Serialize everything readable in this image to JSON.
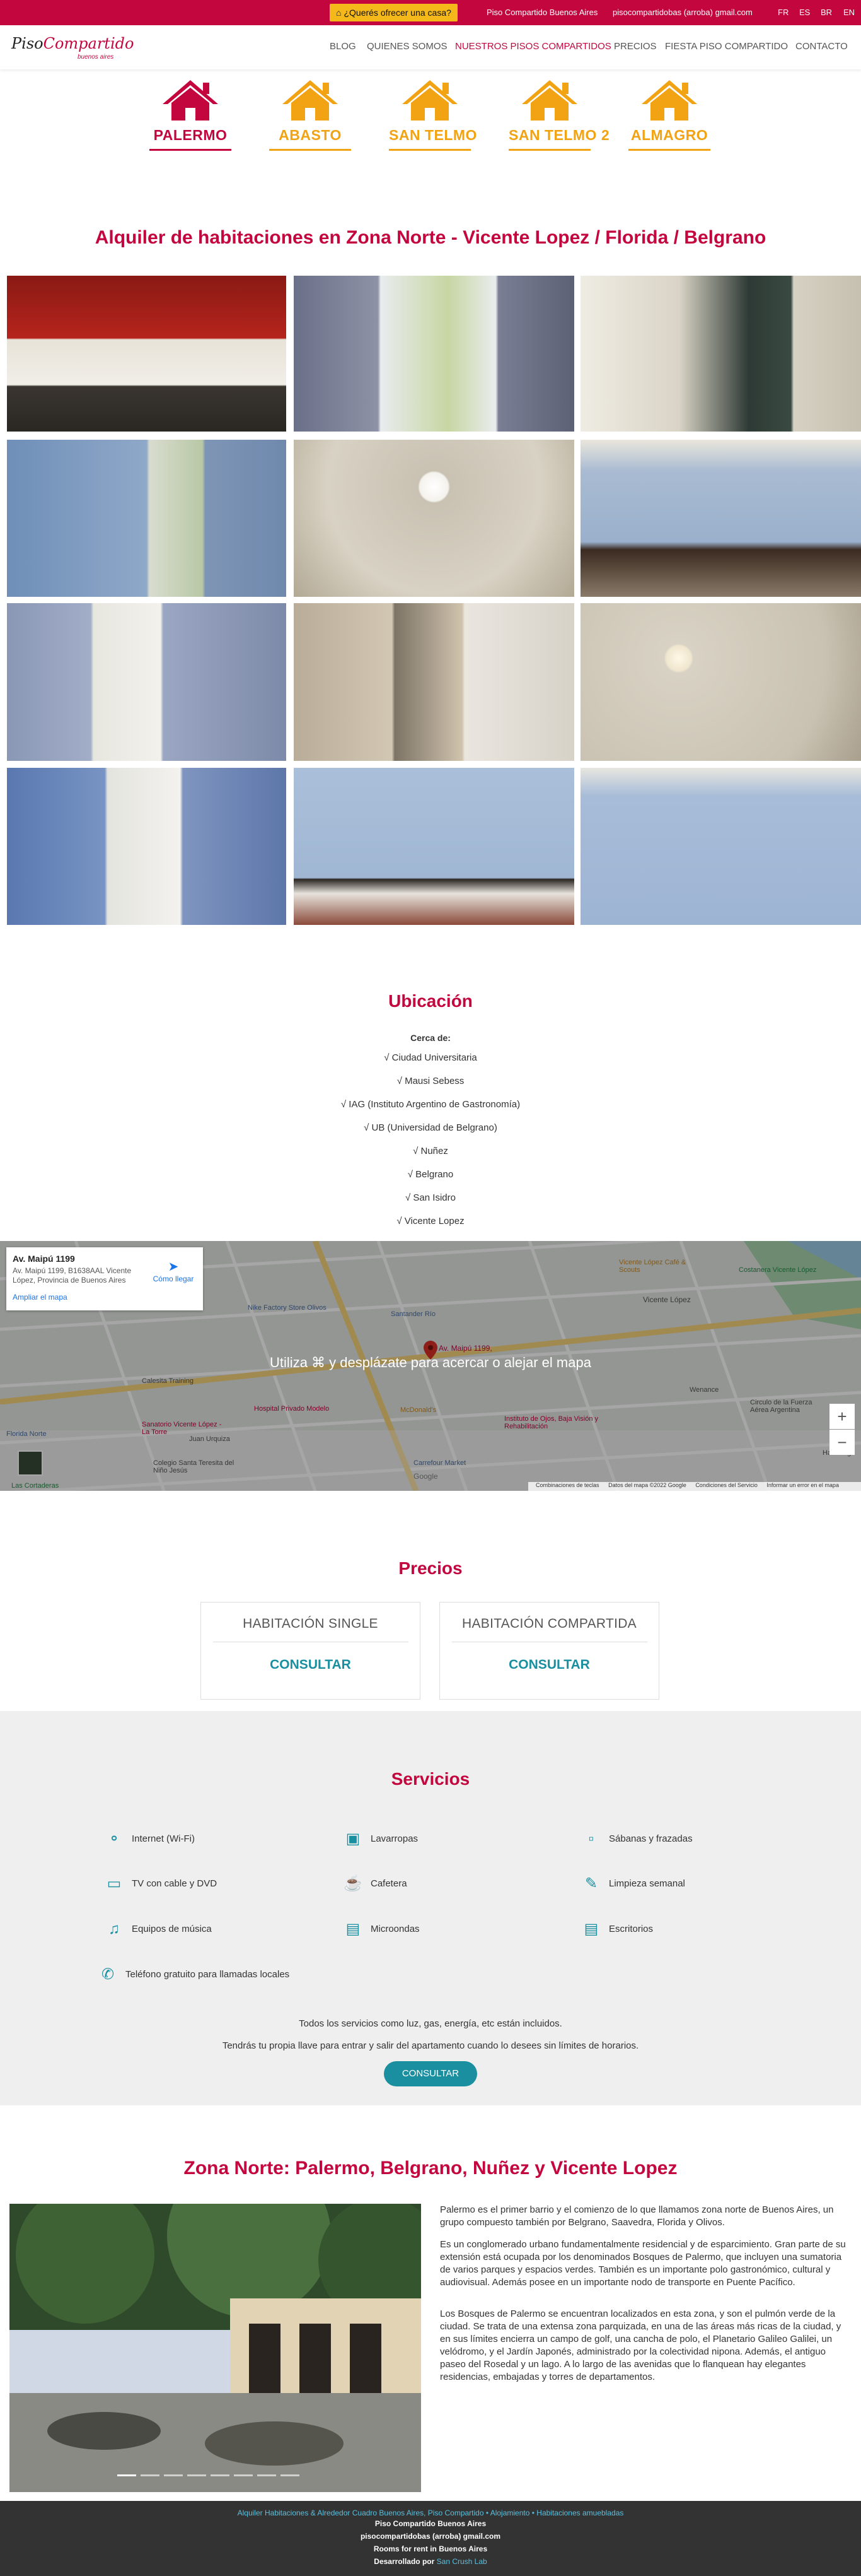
{
  "topbar": {
    "offer_label": "¿Querés ofrecer una casa?",
    "company": "Piso Compartido Buenos Aires",
    "email": "pisocompartidobas (arroba) gmail.com",
    "languages": [
      "FR",
      "ES",
      "BR",
      "EN"
    ]
  },
  "header": {
    "logo_main": "PisoCompartido",
    "logo_sub": "buenos aires",
    "nav": [
      "BLOG",
      "QUIENES SOMOS",
      "NUESTROS PISOS COMPARTIDOS",
      "PRECIOS",
      "FIESTA PISO COMPARTIDO",
      "CONTACTO"
    ],
    "active_nav": "NUESTROS PISOS COMPARTIDOS"
  },
  "locations": [
    {
      "label": "PALERMO",
      "color": "#c4063f",
      "icon": "house-icon"
    },
    {
      "label": "ABASTO",
      "color": "#f2a313",
      "icon": "house-icon"
    },
    {
      "label": "SAN TELMO",
      "color": "#f2a313",
      "icon": "house-icon"
    },
    {
      "label": "SAN TELMO 2",
      "color": "#f2a313",
      "icon": "house-icon"
    },
    {
      "label": "ALMAGRO",
      "color": "#f2a313",
      "icon": "house-icon"
    }
  ],
  "page_title": "Alquiler de habitaciones en Zona Norte - Vicente Lopez / Florida / Belgrano",
  "ubicacion": {
    "title": "Ubicación",
    "near_title": "Cerca de:",
    "near": [
      "√ Ciudad Universitaria",
      "√ Mausi Sebess",
      "√ IAG (Instituto Argentino de Gastronomía)",
      "√ UB (Universidad de Belgrano)",
      "√ Nuñez",
      "√ Belgrano",
      "√ San Isidro",
      "√ Vicente Lopez"
    ]
  },
  "map": {
    "card_title": "Av. Maipú 1199",
    "card_address": "Av. Maipú 1199, B1638AAL Vicente López, Provincia de Buenos Aires",
    "enlarge": "Ampliar el mapa",
    "directions": "Cómo llegar",
    "overlay_msg": "Utiliza ⌘ y desplázate para acercar o alejar el mapa",
    "pin_label": "Av. Maipú 1199,",
    "footer": [
      "Combinaciones de teclas",
      "Datos del mapa ©2022 Google",
      "Condiciones del Servicio",
      "Informar un error en el mapa"
    ],
    "labels": [
      "Nike Factory Store Olivos",
      "Santander Río",
      "Calesita Training",
      "Sanatorio Vicente López - La Torre",
      "Hospital Privado Modelo",
      "McDonald's",
      "Instituto de Ojos, Baja Visión y Rehabilitación",
      "Carrefour Market",
      "Colegio Santa Teresita del Niño Jesús",
      "Vicente López",
      "Costanera Vicente López",
      "Circulo de la Fuerza Aérea Argentina",
      "Las Cortaderas",
      "Florida Norte",
      "Juan Urquiza",
      "Hamburgo",
      "Vicente López Café & Scouts",
      "Wenance",
      "Google"
    ]
  },
  "precios": {
    "title": "Precios",
    "plans": [
      {
        "name": "HABITACIÓN SINGLE",
        "action": "CONSULTAR"
      },
      {
        "name": "HABITACIÓN COMPARTIDA",
        "action": "CONSULTAR"
      }
    ]
  },
  "servicios": {
    "title": "Servicios",
    "items": [
      {
        "label": "Internet (Wi-Fi)",
        "icon": "wifi-icon"
      },
      {
        "label": "Lavarropas",
        "icon": "washing-machine-icon"
      },
      {
        "label": "Sábanas y frazadas",
        "icon": "bed-icon"
      },
      {
        "label": "TV con cable y DVD",
        "icon": "tv-icon"
      },
      {
        "label": "Cafetera",
        "icon": "coffee-icon"
      },
      {
        "label": "Limpieza semanal",
        "icon": "broom-icon"
      },
      {
        "label": "Equipos de música",
        "icon": "music-icon"
      },
      {
        "label": "Microondas",
        "icon": "microwave-icon"
      },
      {
        "label": "Escritorios",
        "icon": "desk-icon"
      },
      {
        "label": "Teléfono gratuito para llamadas locales",
        "icon": "phone-icon"
      }
    ],
    "note1": "Todos los servicios como luz, gas, energía, etc están incluidos.",
    "note2": "Tendrás tu propia llave para entrar y salir del apartamento cuando lo desees sin límites de horarios.",
    "cta": "CONSULTAR"
  },
  "zona": {
    "title": "Zona Norte: Palermo, Belgrano, Nuñez y Vicente Lopez",
    "p1": "Palermo es el primer barrio y el comienzo de lo que llamamos zona norte de Buenos Aires, un grupo compuesto también por Belgrano, Saavedra, Florida y Olivos.",
    "p2": "Es un conglomerado urbano fundamentalmente residencial y de esparcimiento. Gran parte de su extensión está ocupada por los denominados Bosques de Palermo, que incluyen una sumatoria de varios parques y espacios verdes. También es un importante polo gastronómico, cultural y audiovisual. Además posee en un importante nodo de transporte en Puente Pacífico.",
    "p3": "Los Bosques de Palermo se encuentran localizados en esta zona, y son el pulmón verde de la ciudad. Se trata de una extensa zona parquizada, en una de las áreas más ricas de la ciudad, y en sus límites encierra un campo de golf, una cancha de polo, el Planetario Galileo Galilei, un velódromo, y el Jardín Japonés, administrado por la colectividad nipona. Además, el antiguo paseo del Rosedal y un lago. A lo largo de las avenidas que lo flanquean hay elegantes residencias, embajadas y torres de departamentos.",
    "slides": 8,
    "active_slide": 1
  },
  "footer": {
    "links": "Alquiler Habitaciones & Alrededor Cuadro Buenos Aires, Piso Compartido • Alojamiento • Habitaciones amuebladas",
    "company": "Piso Compartido Buenos Aires",
    "email": "pisocompartidobas (arroba) gmail.com",
    "tagline": "Rooms for rent in Buenos Aires",
    "dev_label": "Desarrollado por",
    "dev": "San Crush Lab"
  }
}
